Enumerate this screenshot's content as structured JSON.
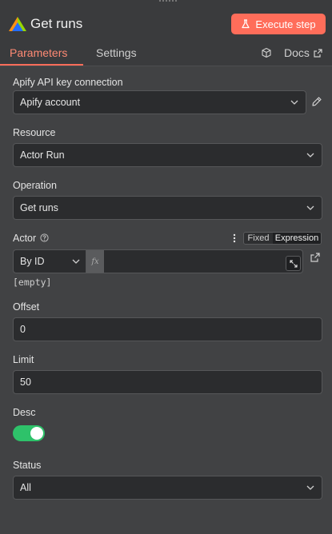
{
  "header": {
    "title": "Get runs",
    "execute_label": "Execute step",
    "brand_color": "#ff6d5a"
  },
  "tabs": [
    {
      "label": "Parameters",
      "active": true
    },
    {
      "label": "Settings",
      "active": false
    }
  ],
  "docs_label": "Docs",
  "fields": {
    "credential": {
      "label": "Apify API key connection",
      "value": "Apify account"
    },
    "resource": {
      "label": "Resource",
      "value": "Actor Run"
    },
    "operation": {
      "label": "Operation",
      "value": "Get runs"
    },
    "actor": {
      "label": "Actor",
      "mode_value": "By ID",
      "fx": "fx",
      "value": "",
      "mode_toggle": {
        "fixed": "Fixed",
        "expression": "Expression",
        "selected": "Expression"
      },
      "preview": "[empty]"
    },
    "offset": {
      "label": "Offset",
      "value": "0"
    },
    "limit": {
      "label": "Limit",
      "value": "50"
    },
    "desc": {
      "label": "Desc",
      "enabled": true
    },
    "status": {
      "label": "Status",
      "value": "All"
    }
  },
  "icons": {
    "logo": "apify-logo-icon",
    "flask": "flask-icon",
    "cube": "cube-icon",
    "external": "external-link-icon",
    "pencil": "pencil-icon",
    "help": "help-circle-icon",
    "kebab": "kebab-menu-icon",
    "chevron": "chevron-down-icon",
    "expand": "expand-icon"
  },
  "colors": {
    "toggle_on": "#2ec26a",
    "tab_active": "#ff8a74"
  }
}
